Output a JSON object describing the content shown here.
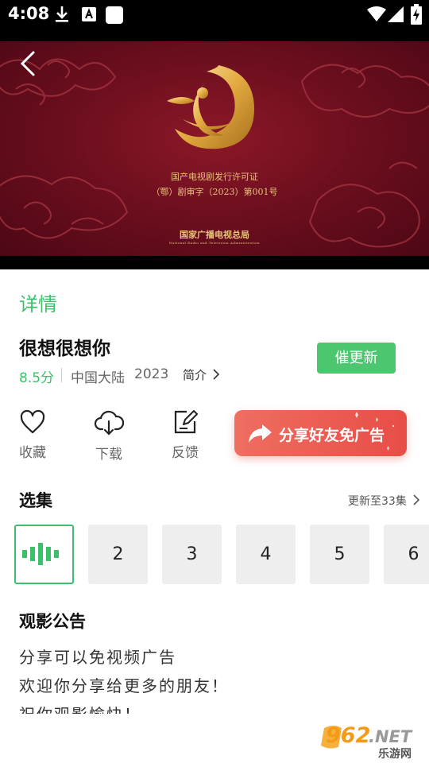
{
  "status_bar": {
    "time": "4:08"
  },
  "video": {
    "license_line1": "国产电视剧发行许可证",
    "license_line2": "（鄂）剧审字（2023）第001号",
    "authority": "国家广播电视总局",
    "authority_en": "National Radio and Television Administration"
  },
  "details_tab": "详情",
  "show": {
    "title": "很想很想你",
    "rating": "8.5分",
    "region": "中国大陆",
    "year": "2023",
    "intro_label": "简介",
    "urge_update_label": "催更新"
  },
  "actions": {
    "favorite": "收藏",
    "download": "下载",
    "feedback": "反馈",
    "share_label": "分享好友免广告"
  },
  "episodes": {
    "title": "选集",
    "update_info": "更新至33集",
    "items": [
      "2",
      "3",
      "4",
      "5",
      "6"
    ]
  },
  "notice": {
    "title": "观影公告",
    "lines": [
      "分享可以免视频广告",
      "欢迎你分享给更多的朋友！",
      "祝你观影愉快！"
    ]
  },
  "watermark": {
    "brand": "962",
    "suffix": ".NET",
    "sub": "乐游网"
  },
  "colors": {
    "accent": "#3cc16b",
    "share": "#e95a50",
    "video_bg": "#7a1124",
    "gold": "#e8c27a"
  }
}
